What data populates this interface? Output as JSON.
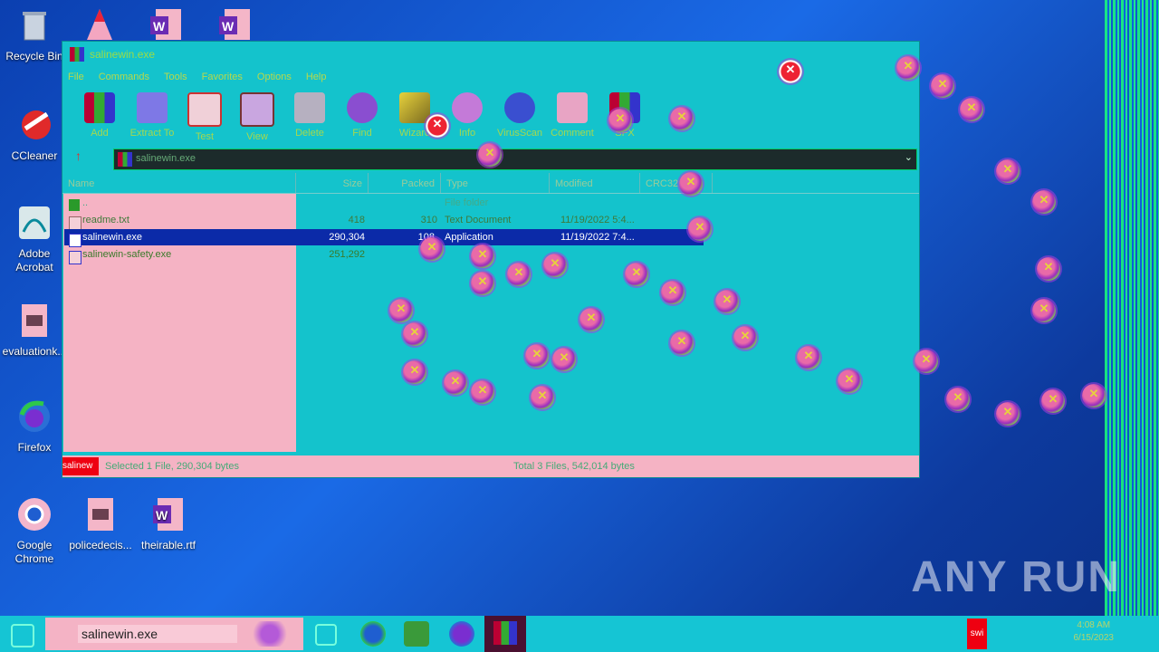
{
  "desktop": {
    "icons": [
      {
        "label": "Recycle Bin",
        "icon": "recycle-bin-icon"
      },
      {
        "label": "CCleaner",
        "icon": "ccleaner-icon"
      },
      {
        "label": "Adobe Acrobat",
        "icon": "acrobat-icon"
      },
      {
        "label": "evaluationk...",
        "icon": "image-file-icon"
      },
      {
        "label": "Firefox",
        "icon": "firefox-icon"
      },
      {
        "label": "Google Chrome",
        "icon": "chrome-icon"
      },
      {
        "label": "policedecis...",
        "icon": "image-file-icon"
      },
      {
        "label": "theirable.rtf",
        "icon": "word-icon"
      }
    ]
  },
  "window": {
    "title": "salinewin.exe",
    "menu": [
      "File",
      "Commands",
      "Tools",
      "Favorites",
      "Options",
      "Help"
    ],
    "toolbar": [
      "Add",
      "Extract To",
      "Test",
      "View",
      "Delete",
      "Find",
      "Wizard",
      "Info",
      "VirusScan",
      "Comment",
      "SFX"
    ],
    "address": "salinewin.exe",
    "columns": [
      "Name",
      "Size",
      "Packed",
      "Type",
      "Modified",
      "CRC32"
    ],
    "rows": [
      {
        "name": "..",
        "size": "",
        "packed": "",
        "type": "File folder",
        "modified": ""
      },
      {
        "name": "readme.txt",
        "size": "418",
        "packed": "310",
        "type": "Text Document",
        "modified": "11/19/2022 5:4..."
      },
      {
        "name": "salinewin.exe",
        "size": "290,304",
        "packed": "108,",
        "type": "Application",
        "modified": "11/19/2022 7:4..."
      },
      {
        "name": "salinewin-safety.exe",
        "size": "251,292",
        "packed": "",
        "type": "",
        "modified": ""
      }
    ],
    "status_icon_text": "salinew",
    "status_left": "Selected 1 File, 290,304 bytes",
    "status_right": "Total 3 Files, 542,014 bytes"
  },
  "taskbar": {
    "search_value": "salinewin.exe",
    "tray_time": "4:08 AM",
    "tray_date": "6/15/2023",
    "tray_app": "swi"
  },
  "watermark": "ANY RUN",
  "colors": {
    "window_bg": "#14c3cc",
    "left_pane": "#f5b3c4",
    "selection": "#0b2aa8",
    "taskbar": "#15c5d4"
  }
}
